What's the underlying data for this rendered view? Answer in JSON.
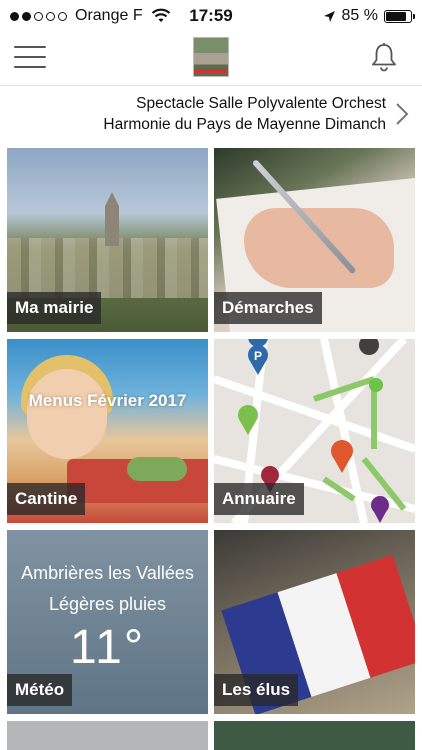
{
  "status_bar": {
    "carrier": "Orange F",
    "time": "17:59",
    "battery": "85 %",
    "battery_level": 0.85,
    "signal_bars": 2
  },
  "header": {
    "menu_icon": "hamburger-menu-icon",
    "logo_icon": "town-logo",
    "notifications_icon": "bell-icon"
  },
  "ticker": {
    "line1": "Spectacle Salle Polyvalente     Orchest",
    "line2": "Harmonie du Pays de Mayenne Dimanch",
    "next_icon": "chevron-right-icon"
  },
  "tiles": {
    "mairie": {
      "label": "Ma mairie"
    },
    "demarches": {
      "label": "Démarches"
    },
    "cantine": {
      "label": "Cantine",
      "overlay": "Menus Février 2017"
    },
    "annuaire": {
      "label": "Annuaire"
    },
    "meteo": {
      "label": "Météo",
      "city": "Ambrières les Vallées",
      "condition": "Légères pluies",
      "temperature": "11°"
    },
    "elus": {
      "label": "Les élus"
    }
  },
  "colors": {
    "label_bg": "#2b2b2b",
    "label_text": "#ffffff",
    "accent_green": "#6cc24a"
  }
}
